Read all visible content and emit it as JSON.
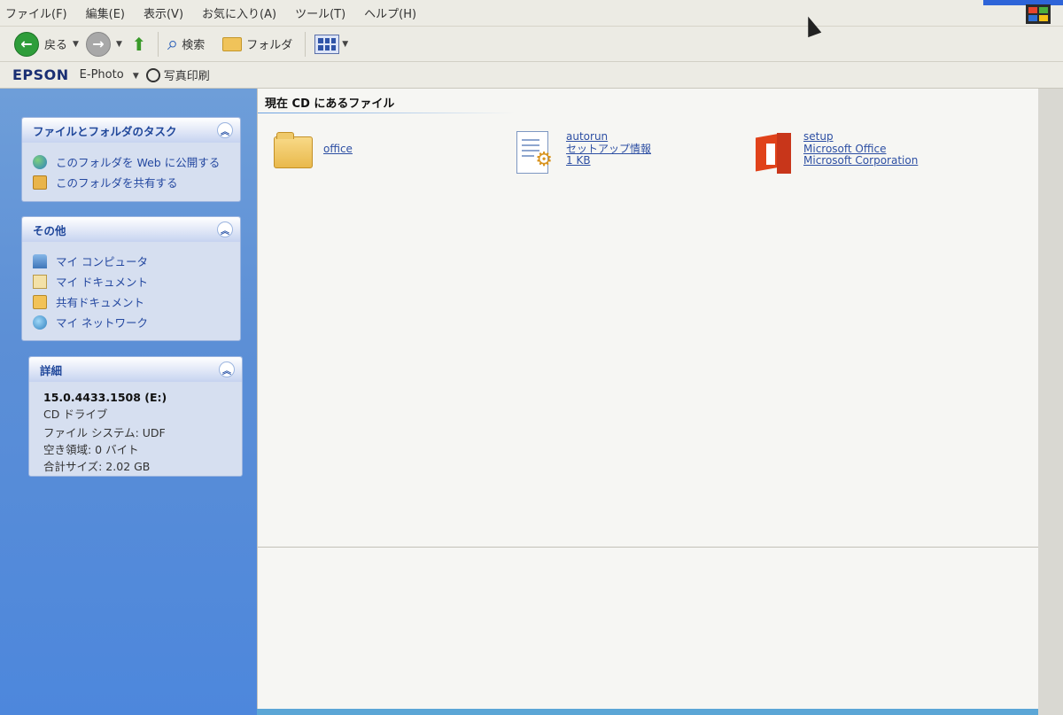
{
  "menu": {
    "items": [
      "ファイル(F)",
      "編集(E)",
      "表示(V)",
      "お気に入り(A)",
      "ツール(T)",
      "ヘルプ(H)"
    ]
  },
  "toolbar": {
    "back_label": "戻る",
    "search_label": "検索",
    "folders_label": "フォルダ"
  },
  "epson": {
    "logo": "EPSON",
    "ephoto_label": "E-Photo",
    "print_label": "写真印刷"
  },
  "tasks": {
    "title": "ファイルとフォルダのタスク",
    "items": [
      "このフォルダを Web に公開する",
      "このフォルダを共有する"
    ]
  },
  "other": {
    "title": "その他",
    "items": [
      "マイ コンピュータ",
      "マイ ドキュメント",
      "共有ドキュメント",
      "マイ ネットワーク"
    ]
  },
  "details": {
    "title": "詳細",
    "name": "15.0.4433.1508 (E:)",
    "type": "CD ドライブ",
    "filesystem": "ファイル システム: UDF",
    "free_space": "空き領域: 0 バイト",
    "total_size": "合計サイズ: 2.02 GB"
  },
  "content": {
    "group_title": "現在 CD にあるファイル",
    "files": [
      {
        "name": "office"
      },
      {
        "name": "autorun",
        "type": "セットアップ情報",
        "size": "1 KB"
      },
      {
        "name": "setup",
        "product": "Microsoft Office",
        "company": "Microsoft Corporation"
      }
    ]
  },
  "colors": {
    "left_pane": "#5c8fd6",
    "panel_title": "#21489b",
    "link": "#2448a0",
    "office_red": "#e0421a"
  }
}
